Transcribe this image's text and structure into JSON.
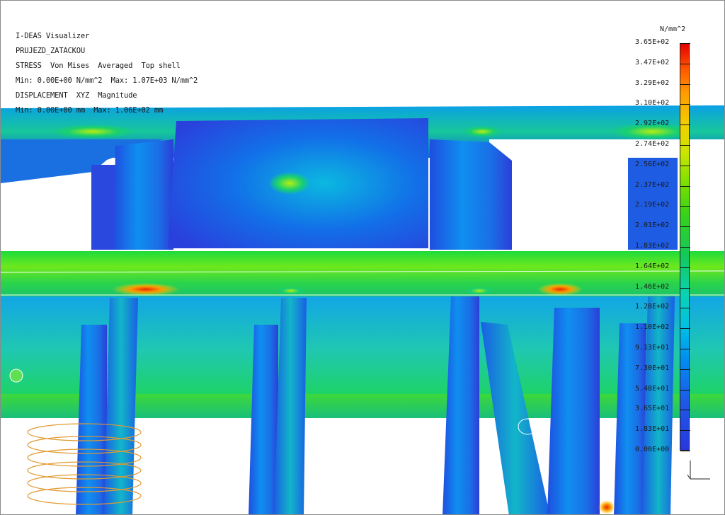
{
  "app": {
    "title": "I-DEAS Visualizer",
    "model_name": "PRUJEZD_ZATACKOU"
  },
  "result_info": {
    "stress_line": "STRESS  Von Mises  Averaged  Top shell",
    "stress_range": "Min: 0.00E+00 N/mm^2  Max: 1.07E+03 N/mm^2",
    "displacement_line": "DISPLACEMENT  XYZ  Magnitude",
    "displacement_range": "Min: 0.00E+00 mm  Max: 1.06E+02 mm"
  },
  "legend": {
    "unit": "N/mm^2",
    "ticks": [
      "3.65E+02",
      "3.47E+02",
      "3.29E+02",
      "3.10E+02",
      "2.92E+02",
      "2.74E+02",
      "2.56E+02",
      "2.37E+02",
      "2.19E+02",
      "2.01E+02",
      "1.83E+02",
      "1.64E+02",
      "1.46E+02",
      "1.28E+02",
      "1.10E+02",
      "9.13E+01",
      "7.30E+01",
      "5.48E+01",
      "3.65E+01",
      "1.83E+01",
      "0.00E+00"
    ],
    "colors": {
      "max": "#e60000",
      "high": "#ff9a00",
      "mid_high": "#f2d000",
      "mid": "#38d21a",
      "mid_low": "#00bfe6",
      "low": "#2838dc"
    }
  }
}
